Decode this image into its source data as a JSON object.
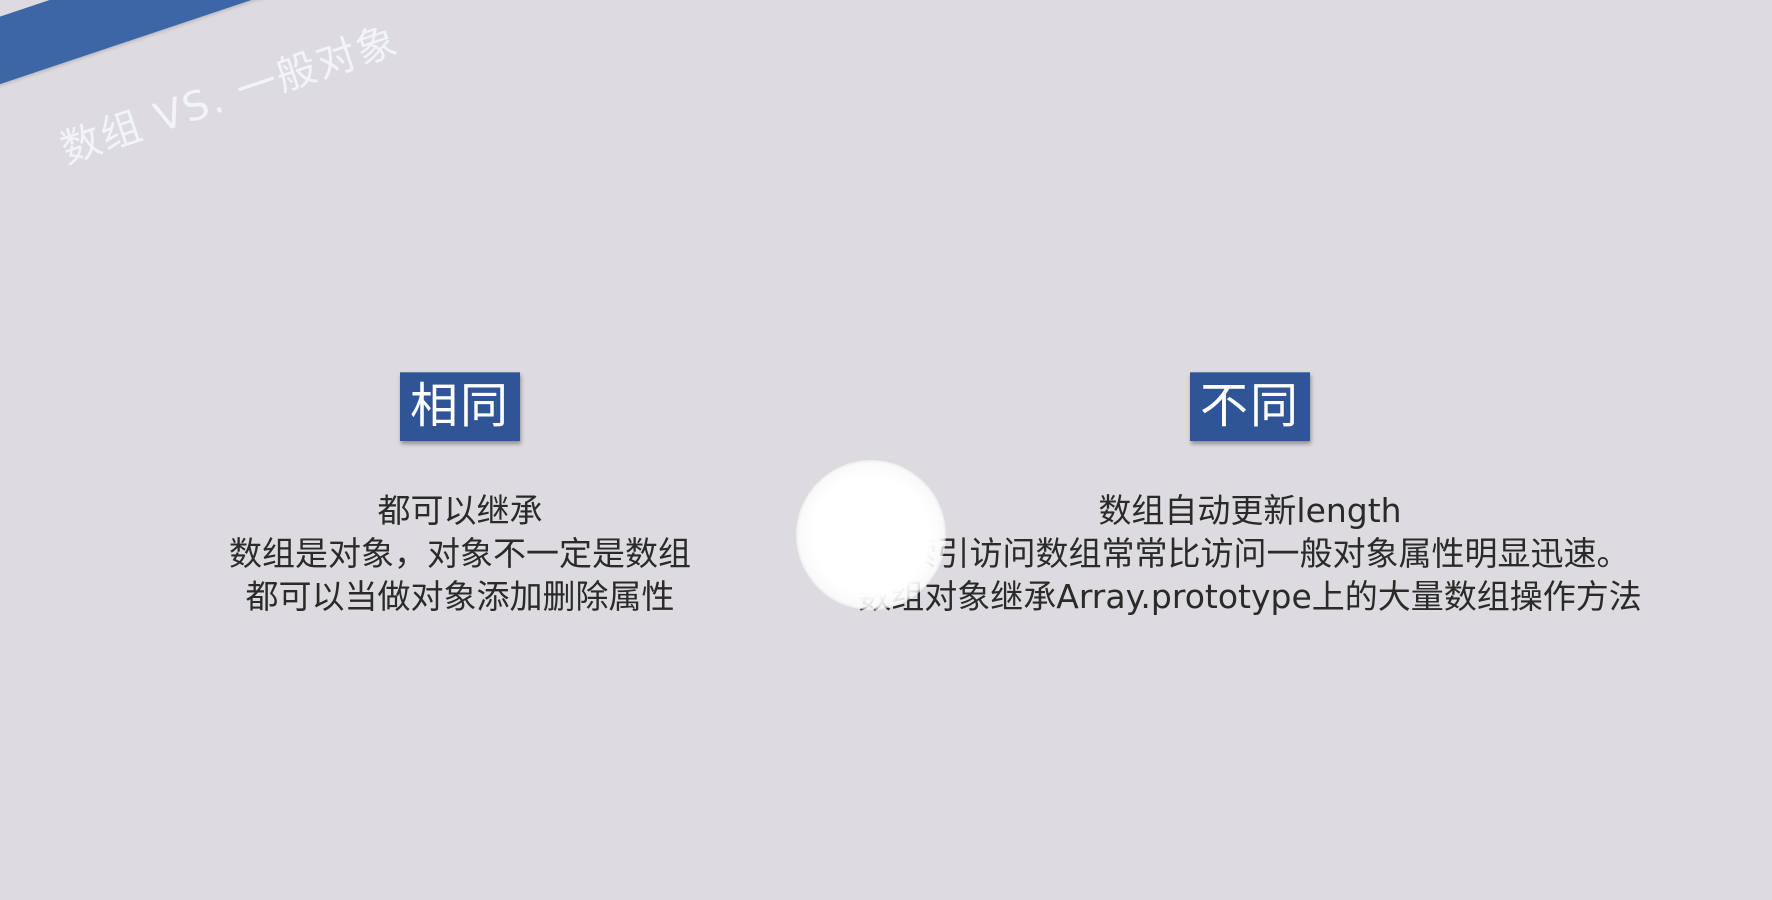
{
  "title": "数组 VS. 一般对象",
  "same": {
    "heading": "相同",
    "lines": [
      "都可以继承",
      "数组是对象，对象不一定是数组",
      "都可以当做对象添加删除属性"
    ]
  },
  "different": {
    "heading": "不同",
    "lines": [
      "数组自动更新length",
      "按索引访问数组常常比访问一般对象属性明显迅速。",
      "数组对象继承Array.prototype上的大量数组操作方法"
    ]
  },
  "colors": {
    "banner": "#3d66a6",
    "heading_bg": "#2f5596",
    "background": "#dddbdf"
  }
}
